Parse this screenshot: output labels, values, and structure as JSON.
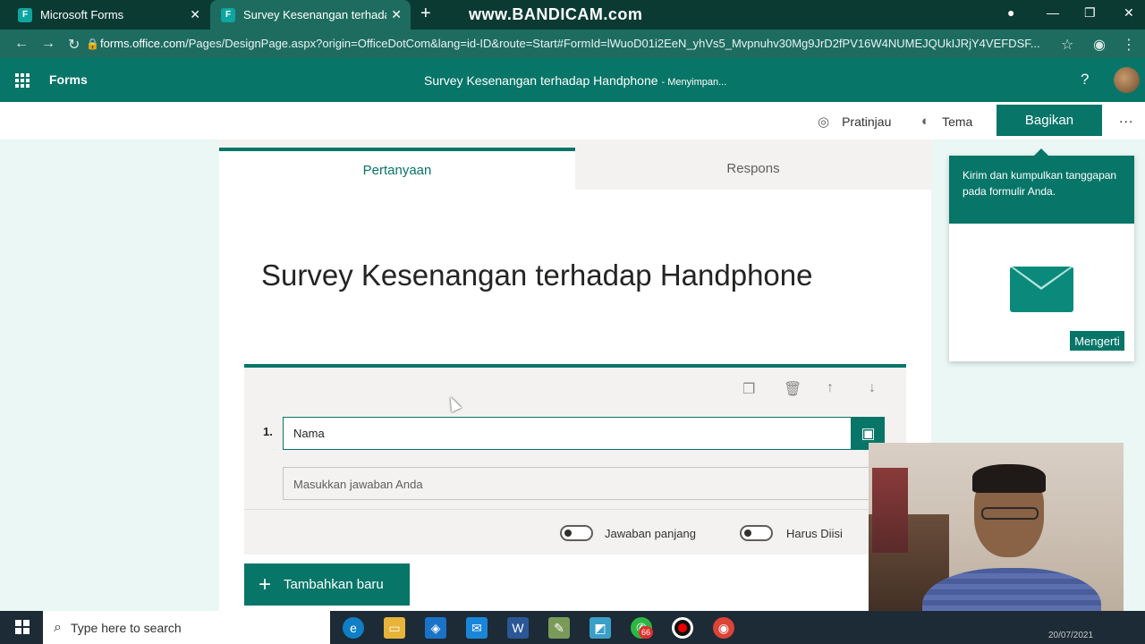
{
  "browser": {
    "tabs": [
      {
        "label": "Microsoft Forms"
      },
      {
        "label": "Survey Kesenangan terhadap Ha..."
      }
    ],
    "watermark": "www.BANDICAM.com",
    "url_domain": "forms.office.com",
    "url_path": "/Pages/DesignPage.aspx?origin=OfficeDotCom&lang=id-ID&route=Start#FormId=lWuoD01i2EeN_yhVs5_Mvpnuhv30Mg9JrD2fPV16W4NUMEJQUkIJRjY4VEFDSF..."
  },
  "appbar": {
    "app_name": "Forms",
    "form_title": "Survey Kesenangan terhadap Handphone",
    "save_status": "- Menyimpan...",
    "help": "?"
  },
  "toolbar": {
    "preview": "Pratinjau",
    "theme": "Tema",
    "share": "Bagikan",
    "more": "..."
  },
  "tabs": {
    "questions": "Pertanyaan",
    "responses": "Respons"
  },
  "form": {
    "title": "Survey Kesenangan terhadap Handphone",
    "question": {
      "number": "1.",
      "text": "Nama",
      "answer_placeholder": "Masukkan jawaban Anda",
      "long_answer_label": "Jawaban panjang",
      "required_label": "Harus Diisi"
    },
    "add_new": "Tambahkan baru"
  },
  "popover": {
    "message": "Kirim dan kumpulkan tanggapan pada formulir Anda.",
    "got_it": "Mengerti"
  },
  "taskbar": {
    "search_placeholder": "Type here to search",
    "badge_count": "66",
    "date": "20/07/2021"
  },
  "colors": {
    "accent": "#077568",
    "chrome": "#1e6c60"
  }
}
